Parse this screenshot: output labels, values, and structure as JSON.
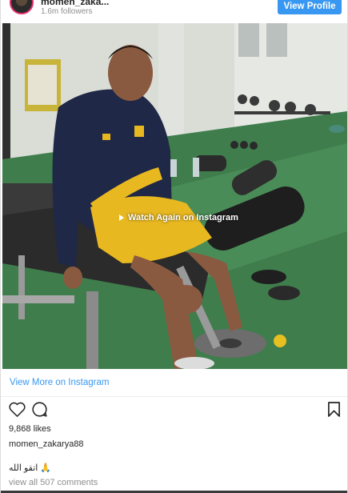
{
  "header": {
    "username": "momen_zaka...",
    "followers": "1.6m followers",
    "view_profile_label": "View Profile"
  },
  "media": {
    "overlay_label": "Watch Again on Instagram",
    "kit_colors": {
      "shirt": "#1f2846",
      "shorts": "#e8b820",
      "floor": "#3f7d4c"
    }
  },
  "footer": {
    "view_more_label": "View More on Instagram",
    "likes": "9,868 likes",
    "caption_username": "momen_zakarya88",
    "caption_text": "اتقو الله 🙏",
    "comments_link": "view all 507 comments"
  },
  "colors": {
    "accent": "#3897f0",
    "text": "#262626",
    "muted": "#8e8e8e"
  }
}
